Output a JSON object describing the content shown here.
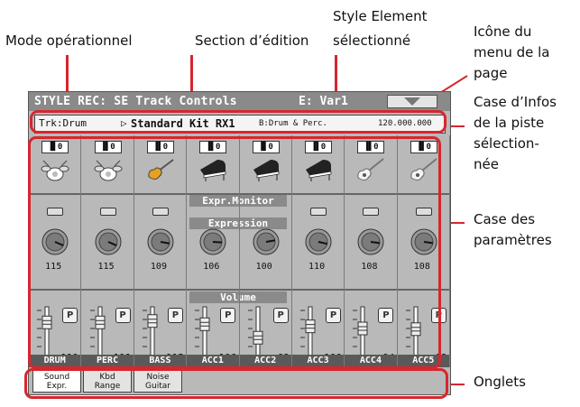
{
  "callouts": {
    "mode": "Mode opérationnel",
    "edit_section": "Section d’édition",
    "style_element_1": "Style Element",
    "style_element_2": "sélectionné",
    "page_menu_1": "Icône du",
    "page_menu_2": "menu de la",
    "page_menu_3": "page",
    "track_info_1": "Case d’Infos",
    "track_info_2": "de la piste",
    "track_info_3": "sélection-",
    "track_info_4": "née",
    "params_1": "Case des",
    "params_2": "paramètres",
    "tabs": "Onglets"
  },
  "header": {
    "title": "STYLE REC: SE Track Controls",
    "element": "E: Var1",
    "menu_icon": "page-menu-triangle-icon"
  },
  "info": {
    "track": "Trk:Drum",
    "arrow": "▷",
    "sound": "Standard Kit RX1",
    "bank": "B:Drum & Perc.",
    "code": "120.000.000"
  },
  "sections": {
    "expr_monitor": "Expr.Monitor",
    "expression": "Expression",
    "volume": "Volume"
  },
  "mute_label": "▐▌0",
  "play_label": "P",
  "tracks": [
    {
      "name": "DRUM",
      "inst": "drum-kit-icon",
      "expr": 115,
      "vol": 111
    },
    {
      "name": "PERC",
      "inst": "drum-kit-icon",
      "expr": 115,
      "vol": 111
    },
    {
      "name": "BASS",
      "inst": "bass-guitar-icon",
      "expr": 109,
      "vol": 115
    },
    {
      "name": "ACC1",
      "inst": "piano-icon",
      "expr": 106,
      "vol": 106
    },
    {
      "name": "ACC2",
      "inst": "piano-icon",
      "expr": 100,
      "vol": 68
    },
    {
      "name": "ACC3",
      "inst": "piano-icon",
      "expr": 110,
      "vol": 100
    },
    {
      "name": "ACC4",
      "inst": "acoustic-guitar-icon",
      "expr": 108,
      "vol": 94
    },
    {
      "name": "ACC5",
      "inst": "acoustic-guitar-icon",
      "expr": 108,
      "vol": 92
    }
  ],
  "tabs": [
    {
      "line1": "Sound",
      "line2": "Expr.",
      "active": true
    },
    {
      "line1": "Kbd",
      "line2": "Range",
      "active": false
    },
    {
      "line1": "Noise",
      "line2": "Guitar",
      "active": false
    }
  ],
  "colors": {
    "accent": "#d7262e",
    "screen": "#b9b9b9",
    "bar": "#8a8a8a"
  }
}
